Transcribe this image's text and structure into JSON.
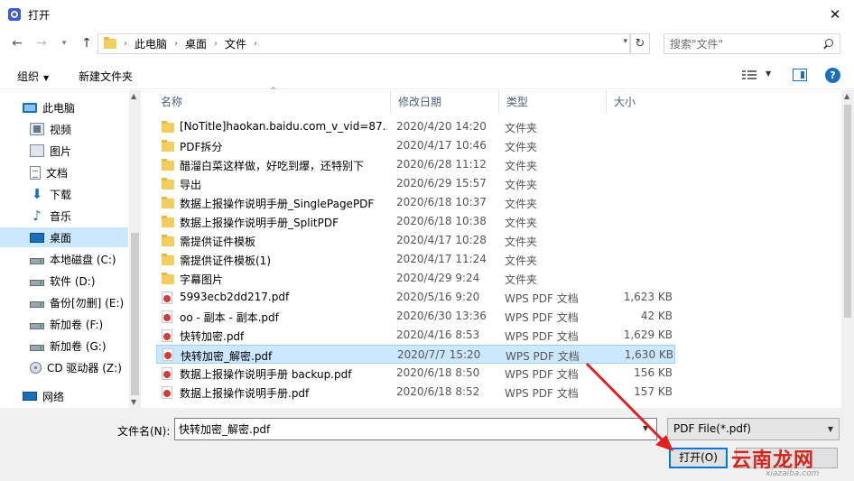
{
  "window": {
    "title": "打开"
  },
  "address": {
    "crumbs": [
      "此电脑",
      "桌面",
      "文件"
    ],
    "search_placeholder": "搜索\"文件\""
  },
  "toolbar": {
    "organize_label": "组织",
    "new_folder_label": "新建文件夹"
  },
  "nav": {
    "items": [
      {
        "label": "此电脑",
        "icon": "pc-icon"
      },
      {
        "label": "视频",
        "icon": "video-icon"
      },
      {
        "label": "图片",
        "icon": "pictures-icon"
      },
      {
        "label": "文档",
        "icon": "document-icon"
      },
      {
        "label": "下载",
        "icon": "download-icon"
      },
      {
        "label": "音乐",
        "icon": "music-icon"
      },
      {
        "label": "桌面",
        "icon": "desktop-icon",
        "selected": true
      },
      {
        "label": "本地磁盘 (C:)",
        "icon": "disk-icon"
      },
      {
        "label": "软件 (D:)",
        "icon": "disk-icon"
      },
      {
        "label": "备份[勿删] (E:)",
        "icon": "disk-icon"
      },
      {
        "label": "新加卷 (F:)",
        "icon": "disk-icon"
      },
      {
        "label": "新加卷 (G:)",
        "icon": "disk-icon"
      },
      {
        "label": "CD 驱动器 (Z:)",
        "icon": "cd-icon"
      },
      {
        "label": "网络",
        "icon": "network-icon"
      }
    ]
  },
  "columns": {
    "name": "名称",
    "date": "修改日期",
    "type": "类型",
    "size": "大小"
  },
  "files": [
    {
      "name": "[NoTitle]haokan.baidu.com_v_vid=87...",
      "date": "2020/4/20 14:20",
      "type": "文件夹",
      "size": "",
      "kind": "folder"
    },
    {
      "name": "PDF拆分",
      "date": "2020/4/17 10:46",
      "type": "文件夹",
      "size": "",
      "kind": "folder"
    },
    {
      "name": "醋溜白菜这样做，好吃到爆，还特别下",
      "date": "2020/6/28 11:12",
      "type": "文件夹",
      "size": "",
      "kind": "folder"
    },
    {
      "name": "导出",
      "date": "2020/6/29 15:57",
      "type": "文件夹",
      "size": "",
      "kind": "folder"
    },
    {
      "name": "数据上报操作说明手册_SinglePagePDF",
      "date": "2020/6/18 10:37",
      "type": "文件夹",
      "size": "",
      "kind": "folder"
    },
    {
      "name": "数据上报操作说明手册_SplitPDF",
      "date": "2020/6/18 10:38",
      "type": "文件夹",
      "size": "",
      "kind": "folder"
    },
    {
      "name": "需提供证件模板",
      "date": "2020/4/17 10:28",
      "type": "文件夹",
      "size": "",
      "kind": "folder"
    },
    {
      "name": "需提供证件模板(1)",
      "date": "2020/4/17 11:24",
      "type": "文件夹",
      "size": "",
      "kind": "folder"
    },
    {
      "name": "字幕图片",
      "date": "2020/4/29 9:24",
      "type": "文件夹",
      "size": "",
      "kind": "folder"
    },
    {
      "name": "5993ecb2dd217.pdf",
      "date": "2020/5/16 9:20",
      "type": "WPS PDF 文档",
      "size": "1,623 KB",
      "kind": "pdf"
    },
    {
      "name": "oo - 副本 - 副本.pdf",
      "date": "2020/6/30 13:36",
      "type": "WPS PDF 文档",
      "size": "42 KB",
      "kind": "pdf"
    },
    {
      "name": "快转加密.pdf",
      "date": "2020/4/16 8:53",
      "type": "WPS PDF 文档",
      "size": "1,629 KB",
      "kind": "pdf"
    },
    {
      "name": "快转加密_解密.pdf",
      "date": "2020/7/7 15:20",
      "type": "WPS PDF 文档",
      "size": "1,630 KB",
      "kind": "pdf",
      "selected": true
    },
    {
      "name": "数据上报操作说明手册 backup.pdf",
      "date": "2020/6/18 8:50",
      "type": "WPS PDF 文档",
      "size": "156 KB",
      "kind": "pdf"
    },
    {
      "name": "数据上报操作说明手册.pdf",
      "date": "2020/6/18 8:52",
      "type": "WPS PDF 文档",
      "size": "157 KB",
      "kind": "pdf"
    }
  ],
  "footer": {
    "filename_label": "文件名(N):",
    "filename_value": "快转加密_解密.pdf",
    "filter_value": "PDF File(*.pdf)",
    "open_label": "打开(O)"
  },
  "watermark": {
    "text": "云南龙网",
    "sub": "xiazaiba.com"
  },
  "colors": {
    "accent": "#0078d7",
    "selection": "#cce8ff",
    "annotation_arrow": "#e02020"
  }
}
